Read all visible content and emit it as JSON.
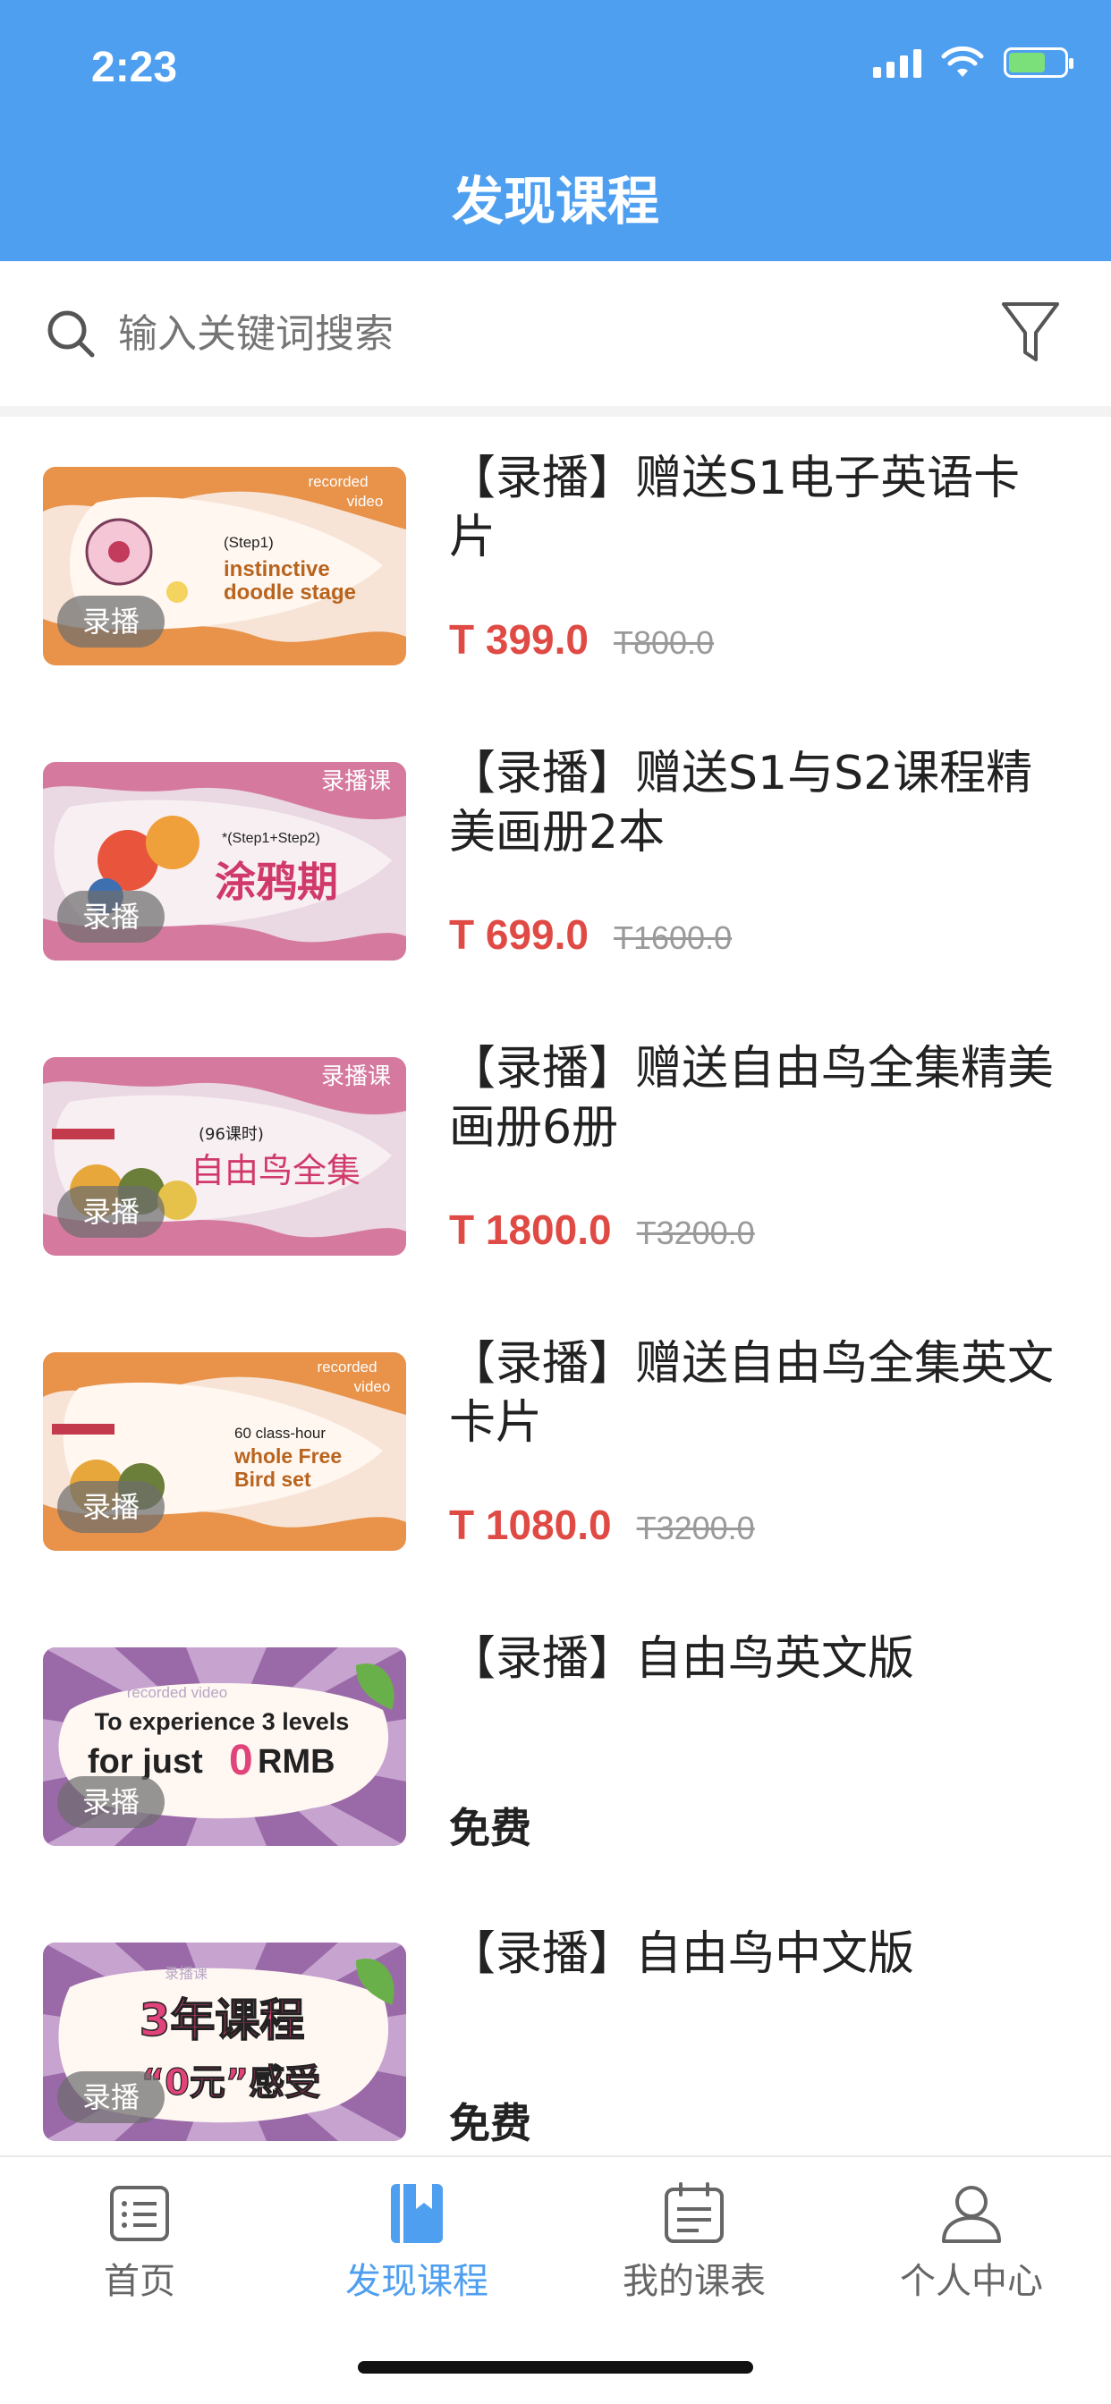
{
  "status_bar": {
    "time": "2:23"
  },
  "header": {
    "title": "发现课程"
  },
  "search": {
    "placeholder": "输入关键词搜索"
  },
  "courses": [
    {
      "badge": "录播",
      "thumb_text_1": "recorded",
      "thumb_text_2": "video",
      "thumb_text_3": "(Step1)",
      "thumb_text_4": "instinctive",
      "thumb_text_5": "doodle stage",
      "title": "【录播】赠送S1电子英语卡片",
      "price": "T 399.0",
      "original_price": "T800.0"
    },
    {
      "badge": "录播",
      "thumb_text_1": "录播课",
      "thumb_text_2": "*(Step1+Step2)",
      "thumb_text_3": "涂鸦期",
      "title": "【录播】赠送S1与S2课程精美画册2本",
      "price": "T 699.0",
      "original_price": "T1600.0"
    },
    {
      "badge": "录播",
      "thumb_text_1": "录播课",
      "thumb_text_2": "(96课时)",
      "thumb_text_3": "自由鸟全集",
      "title": "【录播】赠送自由鸟全集精美画册6册",
      "price": "T 1800.0",
      "original_price": "T3200.0"
    },
    {
      "badge": "录播",
      "thumb_text_1": "recorded",
      "thumb_text_2": "video",
      "thumb_text_3": "60 class-hour",
      "thumb_text_4": "whole Free",
      "thumb_text_5": "Bird set",
      "title": "【录播】赠送自由鸟全集英文卡片",
      "price": "T 1080.0",
      "original_price": "T3200.0"
    },
    {
      "badge": "录播",
      "thumb_text_1": "recorded video",
      "thumb_text_2": "To experience 3 levels",
      "thumb_text_3": "for just",
      "thumb_text_4": "0",
      "thumb_text_5": "RMB",
      "title": "【录播】自由鸟英文版",
      "price_free": "免费"
    },
    {
      "badge": "录播",
      "thumb_text_1": "录播课",
      "thumb_text_2": "3年课程",
      "thumb_text_3": "“0元”感受",
      "title": "【录播】自由鸟中文版",
      "price_free": "免费"
    }
  ],
  "tabs": [
    {
      "label": "首页",
      "icon": "list-icon",
      "active": false
    },
    {
      "label": "发现课程",
      "icon": "bookmark-book-icon",
      "active": true
    },
    {
      "label": "我的课表",
      "icon": "clipboard-icon",
      "active": false
    },
    {
      "label": "个人中心",
      "icon": "person-icon",
      "active": false
    }
  ],
  "colors": {
    "brand_blue": "#4f9ff0",
    "price_red": "#e04a45",
    "muted_gray": "#9a9a9a"
  }
}
